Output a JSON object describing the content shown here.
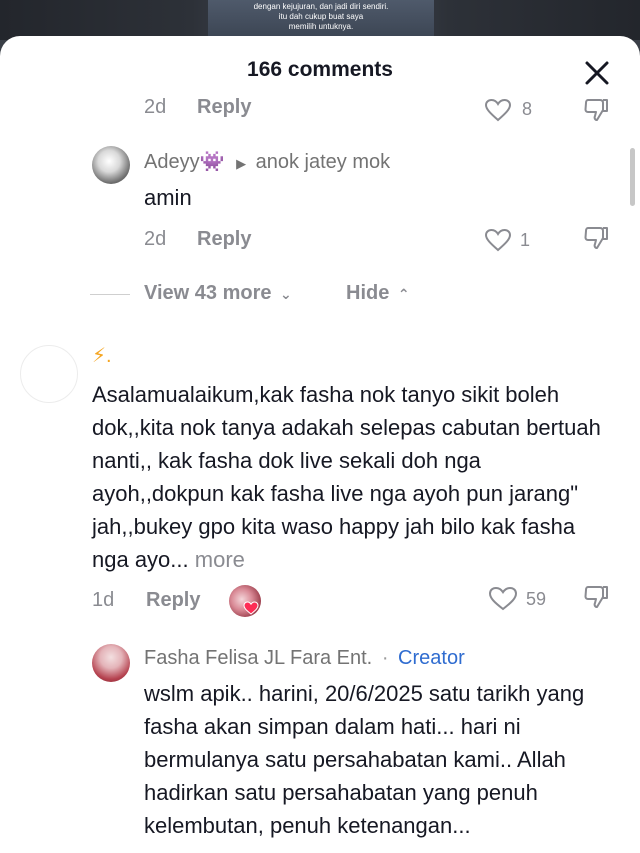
{
  "video": {
    "caption": "dengan kejujuran, dan jadi diri sendiri.\nitu dah cukup buat saya\nmemilih untuknya."
  },
  "header": {
    "title": "166 comments"
  },
  "partial_comment": {
    "age": "2d",
    "reply_label": "Reply",
    "likes": "8"
  },
  "reply1": {
    "username": "Adeyy👾",
    "reply_to": "anok jatey mok",
    "text": "amin",
    "age": "2d",
    "reply_label": "Reply",
    "likes": "1"
  },
  "thread_controls": {
    "view_more": "View 43 more",
    "hide": "Hide"
  },
  "comment2": {
    "username": "⚡.",
    "text": "Asalamualaikum,kak fasha nok tanyo sikit boleh dok,,kita nok tanya adakah selepas cabutan bertuah nanti,, kak fasha dok live sekali doh nga ayoh,,dokpun kak fasha live nga ayoh pun jarang\" jah,,bukey gpo kita waso happy jah bilo kak fasha nga ayo...",
    "more_label": "more",
    "age": "1d",
    "reply_label": "Reply",
    "likes": "59"
  },
  "reply2": {
    "username": "Fasha Felisa JL Fara Ent.",
    "separator": "·",
    "badge": "Creator",
    "text": "wslm apik.. harini, 20/6/2025 satu tarikh yang fasha akan simpan dalam hati... hari ni bermulanya satu persahabatan kami.. Allah hadirkan satu persahabatan yang penuh kelembutan, penuh ketenangan..."
  },
  "colors": {
    "text_primary": "#161823",
    "text_secondary": "#8a8b91",
    "creator_badge": "#2f6cd0"
  }
}
